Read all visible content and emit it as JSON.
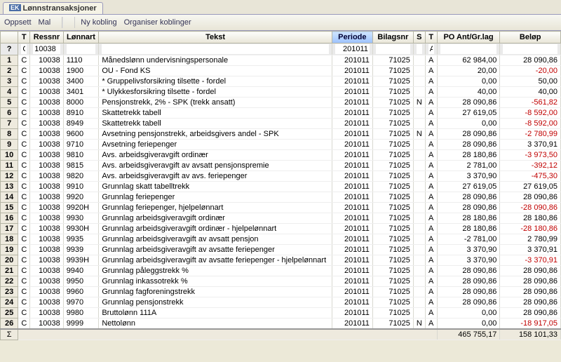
{
  "tab": {
    "ek": "EK",
    "title": "Lønnstransaksjoner"
  },
  "toolbar": {
    "oppsett": "Oppsett",
    "mal": "Mal",
    "nykobling": "Ny kobling",
    "organiser": "Organiser koblinger"
  },
  "headers": {
    "row": "",
    "t": "T",
    "ressnr": "Ressnr",
    "lonnart": "Lønnart",
    "tekst": "Tekst",
    "periode": "Periode",
    "bilagsnr": "Bilagsnr",
    "s": "S",
    "t2": "T",
    "ant": "PO Ant/Gr.lag",
    "belop": "Beløp",
    "q": "?",
    "sigma": "Σ"
  },
  "filter": {
    "t": "C",
    "ressnr": "10038",
    "periode": "201011",
    "t2": "A"
  },
  "rows": [
    {
      "n": "1",
      "t": "C",
      "res": "10038",
      "lon": "1110",
      "txt": "Månedslønn undervisningspersonale",
      "per": "201011",
      "bil": "71025",
      "s": "",
      "t2": "A",
      "ant": "62 984,00",
      "bel": "28 090,86"
    },
    {
      "n": "2",
      "t": "C",
      "res": "10038",
      "lon": "1900",
      "txt": "OU - Fond KS",
      "per": "201011",
      "bil": "71025",
      "s": "",
      "t2": "A",
      "ant": "20,00",
      "bel": "-20,00",
      "neg": true
    },
    {
      "n": "3",
      "t": "C",
      "res": "10038",
      "lon": "3400",
      "txt": "* Gruppelivsforsikring tilsette - fordel",
      "per": "201011",
      "bil": "71025",
      "s": "",
      "t2": "A",
      "ant": "0,00",
      "bel": "50,00"
    },
    {
      "n": "4",
      "t": "C",
      "res": "10038",
      "lon": "3401",
      "txt": "* Ulykkesforsikring tilsette - fordel",
      "per": "201011",
      "bil": "71025",
      "s": "",
      "t2": "A",
      "ant": "40,00",
      "bel": "40,00"
    },
    {
      "n": "5",
      "t": "C",
      "res": "10038",
      "lon": "8000",
      "txt": "Pensjonstrekk, 2% - SPK (trekk ansatt)",
      "per": "201011",
      "bil": "71025",
      "s": "N",
      "t2": "A",
      "ant": "28 090,86",
      "bel": "-561,82",
      "neg": true
    },
    {
      "n": "6",
      "t": "C",
      "res": "10038",
      "lon": "8910",
      "txt": "Skattetrekk tabell",
      "per": "201011",
      "bil": "71025",
      "s": "",
      "t2": "A",
      "ant": "27 619,05",
      "bel": "-8 592,00",
      "neg": true
    },
    {
      "n": "7",
      "t": "C",
      "res": "10038",
      "lon": "8949",
      "txt": "Skattetrekk tabell",
      "per": "201011",
      "bil": "71025",
      "s": "",
      "t2": "A",
      "ant": "0,00",
      "bel": "-8 592,00",
      "neg": true
    },
    {
      "n": "8",
      "t": "C",
      "res": "10038",
      "lon": "9600",
      "txt": "Avsetning pensjonstrekk, arbeidsgivers andel - SPK",
      "per": "201011",
      "bil": "71025",
      "s": "N",
      "t2": "A",
      "ant": "28 090,86",
      "bel": "-2 780,99",
      "neg": true
    },
    {
      "n": "9",
      "t": "C",
      "res": "10038",
      "lon": "9710",
      "txt": "Avsetning feriepenger",
      "per": "201011",
      "bil": "71025",
      "s": "",
      "t2": "A",
      "ant": "28 090,86",
      "bel": "3 370,91"
    },
    {
      "n": "10",
      "t": "C",
      "res": "10038",
      "lon": "9810",
      "txt": "Avs. arbeidsgiveravgift ordinær",
      "per": "201011",
      "bil": "71025",
      "s": "",
      "t2": "A",
      "ant": "28 180,86",
      "bel": "-3 973,50",
      "neg": true
    },
    {
      "n": "11",
      "t": "C",
      "res": "10038",
      "lon": "9815",
      "txt": "Avs. arbeidsgiveravgift av avsatt pensjonspremie",
      "per": "201011",
      "bil": "71025",
      "s": "",
      "t2": "A",
      "ant": "2 781,00",
      "bel": "-392,12",
      "neg": true
    },
    {
      "n": "12",
      "t": "C",
      "res": "10038",
      "lon": "9820",
      "txt": "Avs. arbeidsgiveravgift av avs. feriepenger",
      "per": "201011",
      "bil": "71025",
      "s": "",
      "t2": "A",
      "ant": "3 370,90",
      "bel": "-475,30",
      "neg": true
    },
    {
      "n": "13",
      "t": "C",
      "res": "10038",
      "lon": "9910",
      "txt": "Grunnlag skatt tabelltrekk",
      "per": "201011",
      "bil": "71025",
      "s": "",
      "t2": "A",
      "ant": "27 619,05",
      "bel": "27 619,05"
    },
    {
      "n": "14",
      "t": "C",
      "res": "10038",
      "lon": "9920",
      "txt": "Grunnlag feriepenger",
      "per": "201011",
      "bil": "71025",
      "s": "",
      "t2": "A",
      "ant": "28 090,86",
      "bel": "28 090,86"
    },
    {
      "n": "15",
      "t": "C",
      "res": "10038",
      "lon": "9920H",
      "txt": "Grunnlag feriepenger, hjelpelønnart",
      "per": "201011",
      "bil": "71025",
      "s": "",
      "t2": "A",
      "ant": "28 090,86",
      "bel": "-28 090,86",
      "neg": true
    },
    {
      "n": "16",
      "t": "C",
      "res": "10038",
      "lon": "9930",
      "txt": "Grunnlag arbeidsgiveravgift ordinær",
      "per": "201011",
      "bil": "71025",
      "s": "",
      "t2": "A",
      "ant": "28 180,86",
      "bel": "28 180,86"
    },
    {
      "n": "17",
      "t": "C",
      "res": "10038",
      "lon": "9930H",
      "txt": "Grunnlag arbeidsgiveravgift ordinær - hjelpelønnart",
      "per": "201011",
      "bil": "71025",
      "s": "",
      "t2": "A",
      "ant": "28 180,86",
      "bel": "-28 180,86",
      "neg": true
    },
    {
      "n": "18",
      "t": "C",
      "res": "10038",
      "lon": "9935",
      "txt": "Grunnlag arbeidsgiveravgift av avsatt pensjon",
      "per": "201011",
      "bil": "71025",
      "s": "",
      "t2": "A",
      "ant": "-2 781,00",
      "bel": "2 780,99"
    },
    {
      "n": "19",
      "t": "C",
      "res": "10038",
      "lon": "9939",
      "txt": "Grunnlag arbeidsgiveravgift av avsatte feriepenger",
      "per": "201011",
      "bil": "71025",
      "s": "",
      "t2": "A",
      "ant": "3 370,90",
      "bel": "3 370,91"
    },
    {
      "n": "20",
      "t": "C",
      "res": "10038",
      "lon": "9939H",
      "txt": "Grunnlag arbeidsgiveravgift av avsatte feriepenger - hjelpelønnart",
      "per": "201011",
      "bil": "71025",
      "s": "",
      "t2": "A",
      "ant": "3 370,90",
      "bel": "-3 370,91",
      "neg": true
    },
    {
      "n": "21",
      "t": "C",
      "res": "10038",
      "lon": "9940",
      "txt": "Grunnlag påleggstrekk %",
      "per": "201011",
      "bil": "71025",
      "s": "",
      "t2": "A",
      "ant": "28 090,86",
      "bel": "28 090,86"
    },
    {
      "n": "22",
      "t": "C",
      "res": "10038",
      "lon": "9950",
      "txt": "Grunnlag inkassotrekk %",
      "per": "201011",
      "bil": "71025",
      "s": "",
      "t2": "A",
      "ant": "28 090,86",
      "bel": "28 090,86"
    },
    {
      "n": "23",
      "t": "C",
      "res": "10038",
      "lon": "9960",
      "txt": "Grunnlag fagforeningstrekk",
      "per": "201011",
      "bil": "71025",
      "s": "",
      "t2": "A",
      "ant": "28 090,86",
      "bel": "28 090,86"
    },
    {
      "n": "24",
      "t": "C",
      "res": "10038",
      "lon": "9970",
      "txt": "Grunnlag pensjonstrekk",
      "per": "201011",
      "bil": "71025",
      "s": "",
      "t2": "A",
      "ant": "28 090,86",
      "bel": "28 090,86"
    },
    {
      "n": "25",
      "t": "C",
      "res": "10038",
      "lon": "9980",
      "txt": "Bruttolønn 111A",
      "per": "201011",
      "bil": "71025",
      "s": "",
      "t2": "A",
      "ant": "0,00",
      "bel": "28 090,86"
    },
    {
      "n": "26",
      "t": "C",
      "res": "10038",
      "lon": "9999",
      "txt": "Nettolønn",
      "per": "201011",
      "bil": "71025",
      "s": "N",
      "t2": "A",
      "ant": "0,00",
      "bel": "-18 917,05",
      "neg": true
    }
  ],
  "sum": {
    "ant": "465 755,17",
    "bel": "158 101,33"
  }
}
